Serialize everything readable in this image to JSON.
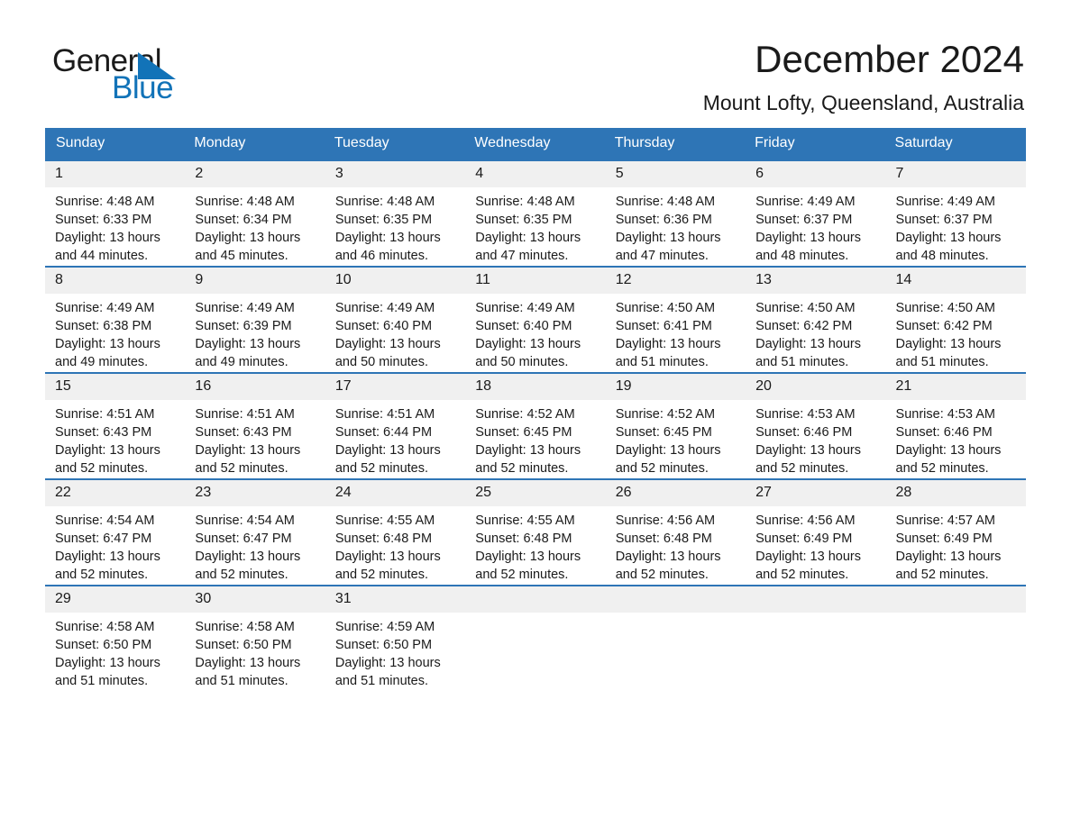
{
  "brand": {
    "name_top": "General",
    "name_bottom": "Blue",
    "accent_color": "#1273b8"
  },
  "header": {
    "title": "December 2024",
    "location": "Mount Lofty, Queensland, Australia"
  },
  "theme": {
    "header_blue": "#2e75b6",
    "daynum_band": "#f0f0f0",
    "text": "#1a1a1a"
  },
  "calendar": {
    "weekday_headers": [
      "Sunday",
      "Monday",
      "Tuesday",
      "Wednesday",
      "Thursday",
      "Friday",
      "Saturday"
    ],
    "weeks": [
      [
        {
          "day": "1",
          "sunrise": "Sunrise: 4:48 AM",
          "sunset": "Sunset: 6:33 PM",
          "daylight": "Daylight: 13 hours and 44 minutes."
        },
        {
          "day": "2",
          "sunrise": "Sunrise: 4:48 AM",
          "sunset": "Sunset: 6:34 PM",
          "daylight": "Daylight: 13 hours and 45 minutes."
        },
        {
          "day": "3",
          "sunrise": "Sunrise: 4:48 AM",
          "sunset": "Sunset: 6:35 PM",
          "daylight": "Daylight: 13 hours and 46 minutes."
        },
        {
          "day": "4",
          "sunrise": "Sunrise: 4:48 AM",
          "sunset": "Sunset: 6:35 PM",
          "daylight": "Daylight: 13 hours and 47 minutes."
        },
        {
          "day": "5",
          "sunrise": "Sunrise: 4:48 AM",
          "sunset": "Sunset: 6:36 PM",
          "daylight": "Daylight: 13 hours and 47 minutes."
        },
        {
          "day": "6",
          "sunrise": "Sunrise: 4:49 AM",
          "sunset": "Sunset: 6:37 PM",
          "daylight": "Daylight: 13 hours and 48 minutes."
        },
        {
          "day": "7",
          "sunrise": "Sunrise: 4:49 AM",
          "sunset": "Sunset: 6:37 PM",
          "daylight": "Daylight: 13 hours and 48 minutes."
        }
      ],
      [
        {
          "day": "8",
          "sunrise": "Sunrise: 4:49 AM",
          "sunset": "Sunset: 6:38 PM",
          "daylight": "Daylight: 13 hours and 49 minutes."
        },
        {
          "day": "9",
          "sunrise": "Sunrise: 4:49 AM",
          "sunset": "Sunset: 6:39 PM",
          "daylight": "Daylight: 13 hours and 49 minutes."
        },
        {
          "day": "10",
          "sunrise": "Sunrise: 4:49 AM",
          "sunset": "Sunset: 6:40 PM",
          "daylight": "Daylight: 13 hours and 50 minutes."
        },
        {
          "day": "11",
          "sunrise": "Sunrise: 4:49 AM",
          "sunset": "Sunset: 6:40 PM",
          "daylight": "Daylight: 13 hours and 50 minutes."
        },
        {
          "day": "12",
          "sunrise": "Sunrise: 4:50 AM",
          "sunset": "Sunset: 6:41 PM",
          "daylight": "Daylight: 13 hours and 51 minutes."
        },
        {
          "day": "13",
          "sunrise": "Sunrise: 4:50 AM",
          "sunset": "Sunset: 6:42 PM",
          "daylight": "Daylight: 13 hours and 51 minutes."
        },
        {
          "day": "14",
          "sunrise": "Sunrise: 4:50 AM",
          "sunset": "Sunset: 6:42 PM",
          "daylight": "Daylight: 13 hours and 51 minutes."
        }
      ],
      [
        {
          "day": "15",
          "sunrise": "Sunrise: 4:51 AM",
          "sunset": "Sunset: 6:43 PM",
          "daylight": "Daylight: 13 hours and 52 minutes."
        },
        {
          "day": "16",
          "sunrise": "Sunrise: 4:51 AM",
          "sunset": "Sunset: 6:43 PM",
          "daylight": "Daylight: 13 hours and 52 minutes."
        },
        {
          "day": "17",
          "sunrise": "Sunrise: 4:51 AM",
          "sunset": "Sunset: 6:44 PM",
          "daylight": "Daylight: 13 hours and 52 minutes."
        },
        {
          "day": "18",
          "sunrise": "Sunrise: 4:52 AM",
          "sunset": "Sunset: 6:45 PM",
          "daylight": "Daylight: 13 hours and 52 minutes."
        },
        {
          "day": "19",
          "sunrise": "Sunrise: 4:52 AM",
          "sunset": "Sunset: 6:45 PM",
          "daylight": "Daylight: 13 hours and 52 minutes."
        },
        {
          "day": "20",
          "sunrise": "Sunrise: 4:53 AM",
          "sunset": "Sunset: 6:46 PM",
          "daylight": "Daylight: 13 hours and 52 minutes."
        },
        {
          "day": "21",
          "sunrise": "Sunrise: 4:53 AM",
          "sunset": "Sunset: 6:46 PM",
          "daylight": "Daylight: 13 hours and 52 minutes."
        }
      ],
      [
        {
          "day": "22",
          "sunrise": "Sunrise: 4:54 AM",
          "sunset": "Sunset: 6:47 PM",
          "daylight": "Daylight: 13 hours and 52 minutes."
        },
        {
          "day": "23",
          "sunrise": "Sunrise: 4:54 AM",
          "sunset": "Sunset: 6:47 PM",
          "daylight": "Daylight: 13 hours and 52 minutes."
        },
        {
          "day": "24",
          "sunrise": "Sunrise: 4:55 AM",
          "sunset": "Sunset: 6:48 PM",
          "daylight": "Daylight: 13 hours and 52 minutes."
        },
        {
          "day": "25",
          "sunrise": "Sunrise: 4:55 AM",
          "sunset": "Sunset: 6:48 PM",
          "daylight": "Daylight: 13 hours and 52 minutes."
        },
        {
          "day": "26",
          "sunrise": "Sunrise: 4:56 AM",
          "sunset": "Sunset: 6:48 PM",
          "daylight": "Daylight: 13 hours and 52 minutes."
        },
        {
          "day": "27",
          "sunrise": "Sunrise: 4:56 AM",
          "sunset": "Sunset: 6:49 PM",
          "daylight": "Daylight: 13 hours and 52 minutes."
        },
        {
          "day": "28",
          "sunrise": "Sunrise: 4:57 AM",
          "sunset": "Sunset: 6:49 PM",
          "daylight": "Daylight: 13 hours and 52 minutes."
        }
      ],
      [
        {
          "day": "29",
          "sunrise": "Sunrise: 4:58 AM",
          "sunset": "Sunset: 6:50 PM",
          "daylight": "Daylight: 13 hours and 51 minutes."
        },
        {
          "day": "30",
          "sunrise": "Sunrise: 4:58 AM",
          "sunset": "Sunset: 6:50 PM",
          "daylight": "Daylight: 13 hours and 51 minutes."
        },
        {
          "day": "31",
          "sunrise": "Sunrise: 4:59 AM",
          "sunset": "Sunset: 6:50 PM",
          "daylight": "Daylight: 13 hours and 51 minutes."
        },
        {
          "day": "",
          "sunrise": "",
          "sunset": "",
          "daylight": ""
        },
        {
          "day": "",
          "sunrise": "",
          "sunset": "",
          "daylight": ""
        },
        {
          "day": "",
          "sunrise": "",
          "sunset": "",
          "daylight": ""
        },
        {
          "day": "",
          "sunrise": "",
          "sunset": "",
          "daylight": ""
        }
      ]
    ]
  }
}
